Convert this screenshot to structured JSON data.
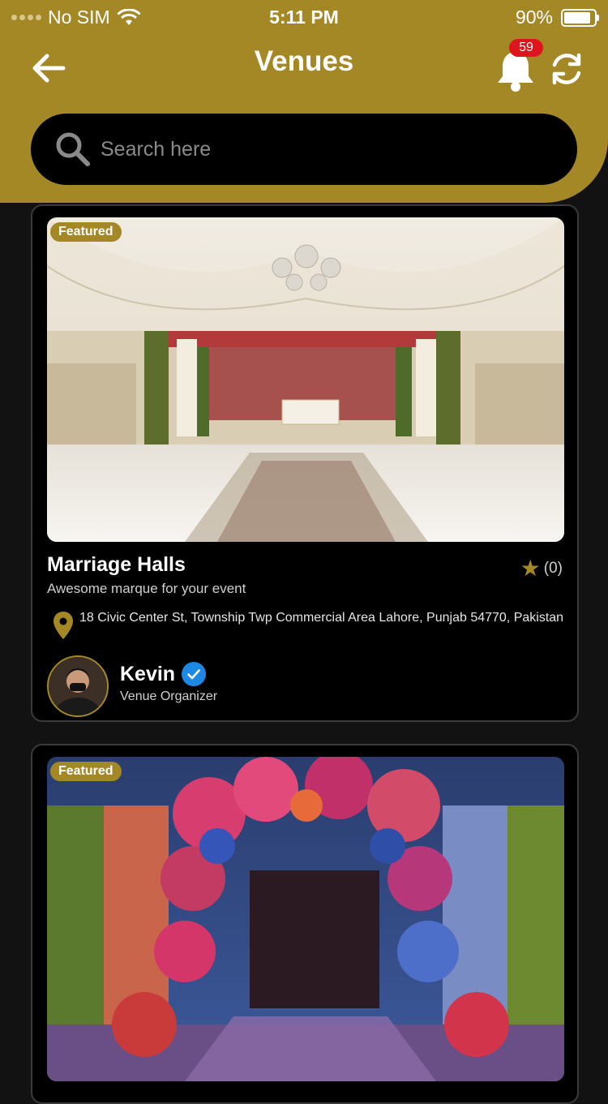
{
  "status_bar": {
    "carrier": "No SIM",
    "time": "5:11 PM",
    "battery": "90%"
  },
  "header": {
    "title": "Venues",
    "notification_count": "59"
  },
  "search": {
    "placeholder": "Search here"
  },
  "venues": [
    {
      "badge": "Featured",
      "name": "Marriage Halls",
      "rating_count": "(0)",
      "description": "Awesome marque for your event",
      "address": "18 Civic Center St, Township Twp Commercial Area Lahore, Punjab 54770, Pakistan",
      "organizer": {
        "name": "Kevin",
        "role": "Venue Organizer"
      }
    },
    {
      "badge": "Featured"
    }
  ],
  "colors": {
    "brand_gold": "#a48826",
    "background": "#121212",
    "card": "#000000",
    "badge_red": "#e0141c",
    "verified_blue": "#1e88e5"
  }
}
